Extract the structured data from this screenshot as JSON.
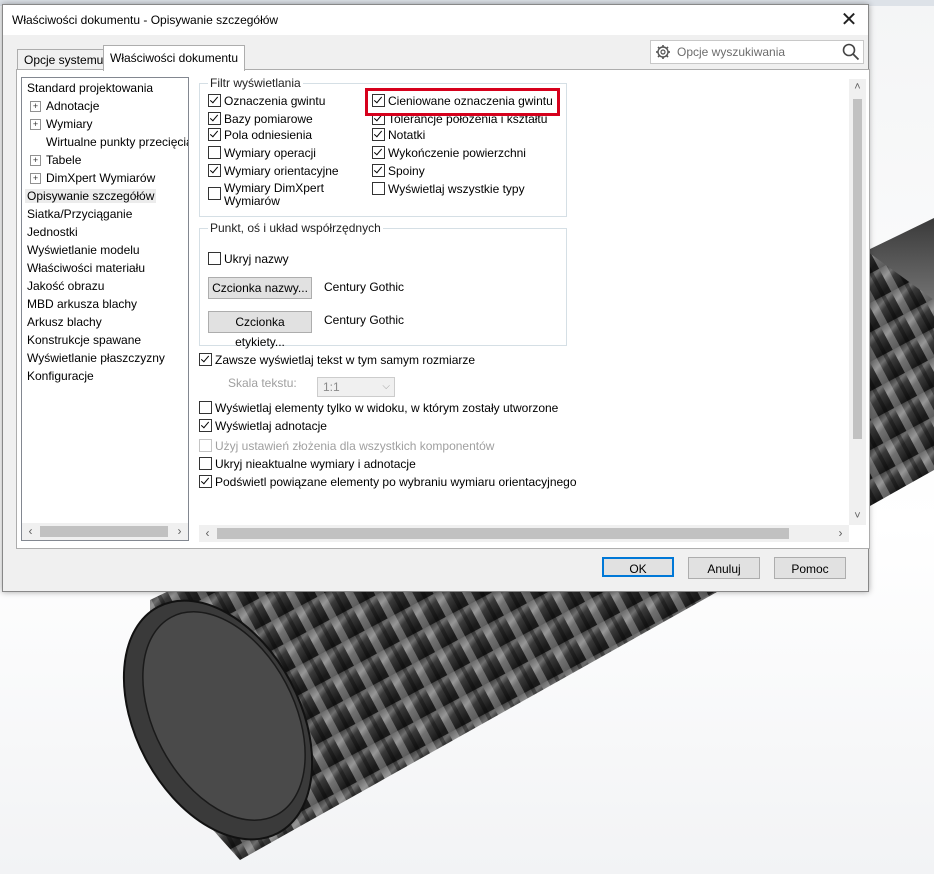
{
  "window": {
    "title": "Właściwości dokumentu - Opisywanie szczegółów"
  },
  "tabs": [
    {
      "label": "Opcje systemu",
      "active": false
    },
    {
      "label": "Właściwości dokumentu",
      "active": true
    }
  ],
  "search": {
    "placeholder": "Opcje wyszukiwania",
    "icon": "gear-icon"
  },
  "tree": {
    "items": [
      {
        "label": "Standard projektowania",
        "expandable": false,
        "indent": 0
      },
      {
        "label": "Adnotacje",
        "expandable": true,
        "indent": 1
      },
      {
        "label": "Wymiary",
        "expandable": true,
        "indent": 1
      },
      {
        "label": "Wirtualne punkty przecięcia",
        "expandable": false,
        "indent": 1
      },
      {
        "label": "Tabele",
        "expandable": true,
        "indent": 1
      },
      {
        "label": "DimXpert Wymiarów",
        "expandable": true,
        "indent": 1
      },
      {
        "label": "Opisywanie szczegółów",
        "expandable": false,
        "indent": 0,
        "selected": true
      },
      {
        "label": "Siatka/Przyciąganie",
        "expandable": false,
        "indent": 0
      },
      {
        "label": "Jednostki",
        "expandable": false,
        "indent": 0
      },
      {
        "label": "Wyświetlanie modelu",
        "expandable": false,
        "indent": 0
      },
      {
        "label": "Właściwości materiału",
        "expandable": false,
        "indent": 0
      },
      {
        "label": "Jakość obrazu",
        "expandable": false,
        "indent": 0
      },
      {
        "label": "MBD arkusza blachy",
        "expandable": false,
        "indent": 0
      },
      {
        "label": "Arkusz blachy",
        "expandable": false,
        "indent": 0
      },
      {
        "label": "Konstrukcje spawane",
        "expandable": false,
        "indent": 0
      },
      {
        "label": "Wyświetlanie płaszczyzny",
        "expandable": false,
        "indent": 0
      },
      {
        "label": "Konfiguracje",
        "expandable": false,
        "indent": 0
      }
    ]
  },
  "display_filter": {
    "title": "Filtr wyświetlania",
    "left": [
      {
        "label": "Oznaczenia gwintu",
        "checked": true
      },
      {
        "label": "Bazy pomiarowe",
        "checked": true
      },
      {
        "label": "Pola odniesienia",
        "checked": true
      },
      {
        "label": "Wymiary operacji",
        "checked": false
      },
      {
        "label": "Wymiary orientacyjne",
        "checked": true
      },
      {
        "label": "Wymiary DimXpert",
        "label2": "Wymiarów",
        "checked": false
      }
    ],
    "right": [
      {
        "label": "Cieniowane oznaczenia gwintu",
        "checked": true,
        "highlighted": true
      },
      {
        "label": "Tolerancje położenia i kształtu",
        "checked": true
      },
      {
        "label": "Notatki",
        "checked": true
      },
      {
        "label": "Wykończenie powierzchni",
        "checked": true
      },
      {
        "label": "Spoiny",
        "checked": true
      },
      {
        "label": "Wyświetlaj wszystkie typy",
        "checked": false
      }
    ]
  },
  "point_axis": {
    "title": "Punkt, oś i układ współrzędnych",
    "hide_names": {
      "label": "Ukryj nazwy",
      "checked": false
    },
    "name_font_button": "Czcionka nazwy...",
    "name_font_value": "Century Gothic",
    "label_font_button": "Czcionka etykiety...",
    "label_font_value": "Century Gothic"
  },
  "options": {
    "same_size": {
      "label": "Zawsze wyświetlaj tekst w tym samym rozmiarze",
      "checked": true
    },
    "text_scale": {
      "label": "Skala tekstu:",
      "value": "1:1",
      "disabled": true
    },
    "only_in_view": {
      "label": "Wyświetlaj elementy tylko w widoku, w którym zostały utworzone",
      "checked": false
    },
    "show_annotations": {
      "label": "Wyświetlaj adnotacje",
      "checked": true
    },
    "assembly_settings": {
      "label": "Użyj ustawień złożenia dla wszystkich komponentów",
      "checked": false,
      "disabled": true
    },
    "hide_dangling": {
      "label": "Ukryj nieaktualne wymiary i adnotacje",
      "checked": false
    },
    "highlight_associated": {
      "label": "Podświetl powiązane elementy po wybraniu wymiaru orientacyjnego",
      "checked": true
    }
  },
  "buttons": {
    "ok": "OK",
    "cancel": "Anuluj",
    "help": "Pomoc"
  }
}
